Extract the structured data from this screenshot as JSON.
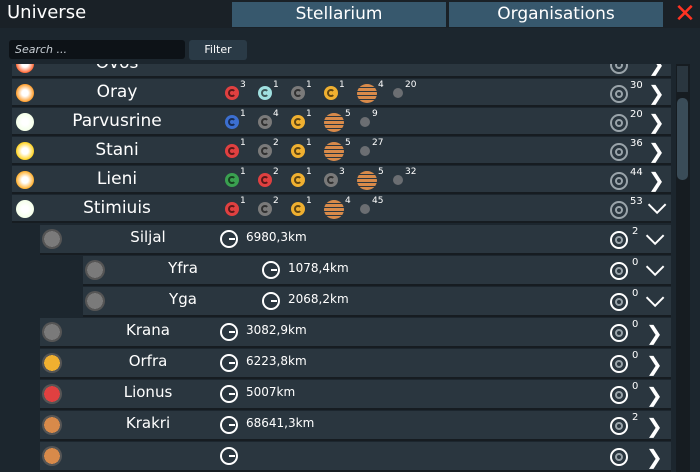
{
  "window": {
    "title": "Universe",
    "close_icon": "close-icon",
    "close_color": "#ff3322"
  },
  "tabs": [
    {
      "label": "Stellarium"
    },
    {
      "label": "Organisations"
    }
  ],
  "search": {
    "placeholder": "Search ...",
    "value": ""
  },
  "filter_label": "Filter",
  "systems": [
    {
      "name": "Ovos",
      "star_color": "#ff6633",
      "moons": [],
      "gas": [],
      "rock": "",
      "orbit_count": "",
      "expanded": false
    },
    {
      "name": "Oray",
      "star_color": "#ff9d2a",
      "moons": [
        {
          "color": "#e04040",
          "count": "3"
        },
        {
          "color": "#a0e0e0",
          "count": "1"
        },
        {
          "color": "#7a7a7a",
          "count": "1"
        },
        {
          "color": "#f0b030",
          "count": "1"
        }
      ],
      "gas": [
        {
          "count": "4"
        }
      ],
      "rock": "20",
      "orbit_count": "30",
      "expanded": false
    },
    {
      "name": "Parvusrine",
      "star_color": "#f4ffe8",
      "moons": [
        {
          "color": "#3c6fd0",
          "count": "1"
        },
        {
          "color": "#7a7a7a",
          "count": "4"
        },
        {
          "color": "#f0b030",
          "count": "1"
        }
      ],
      "gas": [
        {
          "count": "5"
        }
      ],
      "rock": "9",
      "orbit_count": "20",
      "expanded": false
    },
    {
      "name": "Stani",
      "star_color": "#ffd21e",
      "moons": [
        {
          "color": "#e04040",
          "count": "1"
        },
        {
          "color": "#7a7a7a",
          "count": "2"
        },
        {
          "color": "#f0b030",
          "count": "1"
        }
      ],
      "gas": [
        {
          "count": "5"
        }
      ],
      "rock": "27",
      "orbit_count": "36",
      "expanded": false
    },
    {
      "name": "Lieni",
      "star_color": "#ffae2a",
      "moons": [
        {
          "color": "#3aa050",
          "count": "1"
        },
        {
          "color": "#e04040",
          "count": "2"
        },
        {
          "color": "#f0b030",
          "count": "1"
        },
        {
          "color": "#7a7a7a",
          "count": "3"
        }
      ],
      "gas": [
        {
          "count": "5"
        }
      ],
      "rock": "32",
      "orbit_count": "44",
      "expanded": false
    },
    {
      "name": "Stimiuis",
      "star_color": "#f4ffe8",
      "moons": [
        {
          "color": "#e04040",
          "count": "1"
        },
        {
          "color": "#7a7a7a",
          "count": "2"
        },
        {
          "color": "#f0b030",
          "count": "1"
        }
      ],
      "gas": [
        {
          "count": "4"
        }
      ],
      "rock": "45",
      "orbit_count": "53",
      "expanded": true
    }
  ],
  "bodies": [
    {
      "name": "Siljal",
      "icon_color": "#7a7a7a",
      "distance": "6980,3km",
      "moons": "2",
      "level": 1,
      "expanded": true
    },
    {
      "name": "Yfra",
      "icon_color": "#7a7a7a",
      "distance": "1078,4km",
      "moons": "0",
      "level": 2,
      "expanded": true
    },
    {
      "name": "Yga",
      "icon_color": "#7a7a7a",
      "distance": "2068,2km",
      "moons": "0",
      "level": 2,
      "expanded": true
    },
    {
      "name": "Krana",
      "icon_color": "#7a7a7a",
      "distance": "3082,9km",
      "moons": "0",
      "level": 1,
      "expanded": false
    },
    {
      "name": "Orfra",
      "icon_color": "#f0b030",
      "distance": "6223,8km",
      "moons": "0",
      "level": 1,
      "expanded": false
    },
    {
      "name": "Lionus",
      "icon_color": "#e04040",
      "distance": "5007km",
      "moons": "0",
      "level": 1,
      "expanded": false
    },
    {
      "name": "Krakri",
      "icon_color": "#d88a4a",
      "distance": "68641,3km",
      "moons": "2",
      "level": 1,
      "expanded": false
    },
    {
      "name": "",
      "icon_color": "#d88a4a",
      "distance": "",
      "moons": "",
      "level": 1,
      "expanded": false
    }
  ]
}
